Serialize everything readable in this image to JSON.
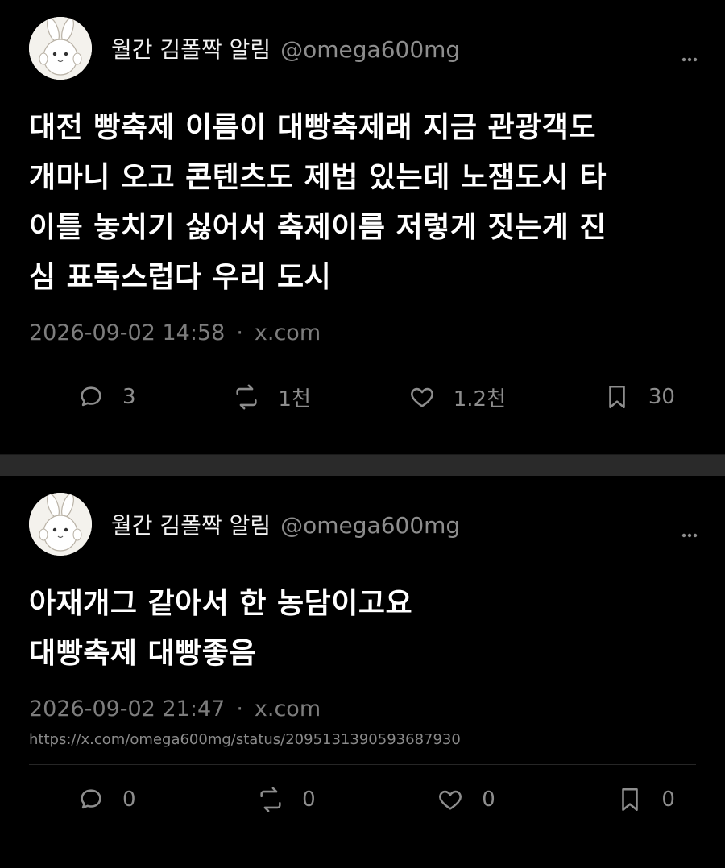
{
  "tweets": [
    {
      "author": {
        "name": "월간 김폴짝 알림",
        "handle": "@omega600mg"
      },
      "more_icon": "more-horizontal-icon",
      "lines": [
        "대전 빵축제 이름이 대빵축제래 지금 관광객도",
        "개마니 오고 콘텐츠도 제법 있는데 노잼도시 타",
        "이틀 놓치기 싫어서 축제이름 저렇게 짓는게 진",
        "심 표독스럽다 우리 도시"
      ],
      "timestamp": "2026-09-02 14:58",
      "source": "x.com",
      "url": "",
      "stats": {
        "replies": "3",
        "reposts": "1천",
        "likes": "1.2천",
        "bookmarks": "30"
      }
    },
    {
      "author": {
        "name": "월간 김폴짝 알림",
        "handle": "@omega600mg"
      },
      "more_icon": "more-horizontal-icon",
      "lines": [
        "아재개그 같아서 한 농담이고요",
        "대빵축제 대빵좋음"
      ],
      "timestamp": "2026-09-02 21:47",
      "source": "x.com",
      "url": "https://x.com/omega600mg/status/2095131390593687930",
      "stats": {
        "replies": "0",
        "reposts": "0",
        "likes": "0",
        "bookmarks": "0"
      }
    }
  ],
  "colors": {
    "background": "#000000",
    "text": "#ffffff",
    "muted": "#8d8d8d",
    "separator": "#2a2a2a"
  }
}
